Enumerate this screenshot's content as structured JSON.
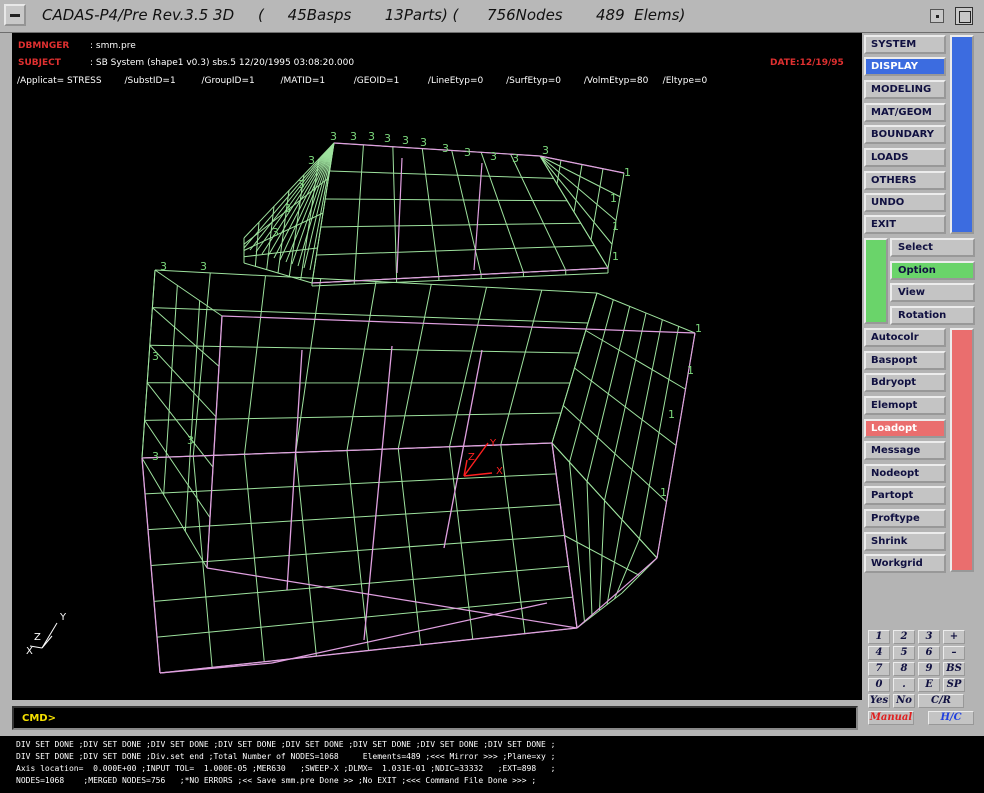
{
  "window": {
    "title": "CADAS-P4/Pre Rev.3.5 3D     (     45Basps       13Parts) (      756Nodes       489  Elems)"
  },
  "header": {
    "dbmnger_label": "DBMNGER",
    "dbmnger_value": ": smm.pre",
    "subject_label": "SUBJECT",
    "subject_value": ": SB System (shape1 v0.3) sbs.5 12/20/1995 03:08:20.000",
    "date": "DATE:12/19/95",
    "attributes": "/Applicat= STRESS        /SubstID=1         /GroupID=1         /MATID=1          /GEOID=1          /LineEtyp=0        /SurfEtyp=0        /VolmEtyp=80     /Eltype=0"
  },
  "main_menu": [
    {
      "label": "SYSTEM",
      "active": false
    },
    {
      "label": "DISPLAY",
      "active": true
    },
    {
      "label": "MODELING",
      "active": false
    },
    {
      "label": "MAT/GEOM",
      "active": false
    },
    {
      "label": "BOUNDARY",
      "active": false
    },
    {
      "label": "LOADS",
      "active": false
    },
    {
      "label": "OTHERS",
      "active": false
    },
    {
      "label": "UNDO",
      "active": false
    },
    {
      "label": "EXIT",
      "active": false
    }
  ],
  "sub_menu": [
    {
      "label": "Select",
      "active": false
    },
    {
      "label": "Option",
      "active": true
    },
    {
      "label": "View",
      "active": false
    },
    {
      "label": "Rotation",
      "active": false
    }
  ],
  "option_menu": [
    {
      "label": "Autocolr",
      "active": false
    },
    {
      "label": "Baspopt",
      "active": false
    },
    {
      "label": "Bdryopt",
      "active": false
    },
    {
      "label": "Elemopt",
      "active": false
    },
    {
      "label": "Loadopt",
      "active": true
    },
    {
      "label": "Message",
      "active": false
    },
    {
      "label": "Nodeopt",
      "active": false
    },
    {
      "label": "Partopt",
      "active": false
    },
    {
      "label": "Proftype",
      "active": false
    },
    {
      "label": "Shrink",
      "active": false
    },
    {
      "label": "Workgrid",
      "active": false
    }
  ],
  "keypad": {
    "keys": [
      "1",
      "2",
      "3",
      "+",
      "4",
      "5",
      "6",
      "–",
      "7",
      "8",
      "9",
      "BS",
      "0",
      ".",
      "E",
      "SP",
      "Yes",
      "No"
    ],
    "cr": "C/R",
    "manual": "Manual",
    "hc": "H/C"
  },
  "colors": {
    "mesh_green": "#9ee29e",
    "mesh_pink": "#e0a0e0",
    "label_green": "#7cd87c",
    "axis_red": "#ff2020",
    "menu_blue": "#3c6ce0",
    "menu_green": "#6ad46a",
    "menu_red": "#ea6e6e"
  },
  "viewport": {
    "node_labels": [
      "3",
      "3",
      "3",
      "3",
      "3",
      "3",
      "3",
      "3",
      "3",
      "3",
      "3",
      "3",
      "3",
      "3",
      "3",
      "3",
      "3",
      "3",
      "3",
      "3",
      "1",
      "1",
      "1",
      "1",
      "1",
      "1",
      "1",
      "1"
    ],
    "triad_labels": [
      "Y",
      "Z",
      "X"
    ],
    "load_labels": [
      "Y",
      "Z",
      "X"
    ]
  },
  "command": {
    "prompt": "CMD>",
    "value": ""
  },
  "console": [
    "DIV SET DONE ;DIV SET DONE ;DIV SET DONE ;DIV SET DONE ;DIV SET DONE ;DIV SET DONE ;DIV SET DONE ;DIV SET DONE ;",
    "DIV SET DONE ;DIV SET DONE ;Div.set end ;Total Number of NODES=1068     Elements=489 ;<<< Mirror >>> ;Plane=xy ;",
    "Axis location=  0.000E+00 ;INPUT TOL=  1.000E-05 ;MER630   ;SWEEP-X ;DLMX=  1.031E-01 ;NDIC=33332   ;EXT=898   ;",
    "NODES=1068    ;MERGED NODES=756   ;*NO ERRORS ;<< Save smm.pre Done >> ;No EXIT ;<<< Command File Done >>> ;"
  ]
}
